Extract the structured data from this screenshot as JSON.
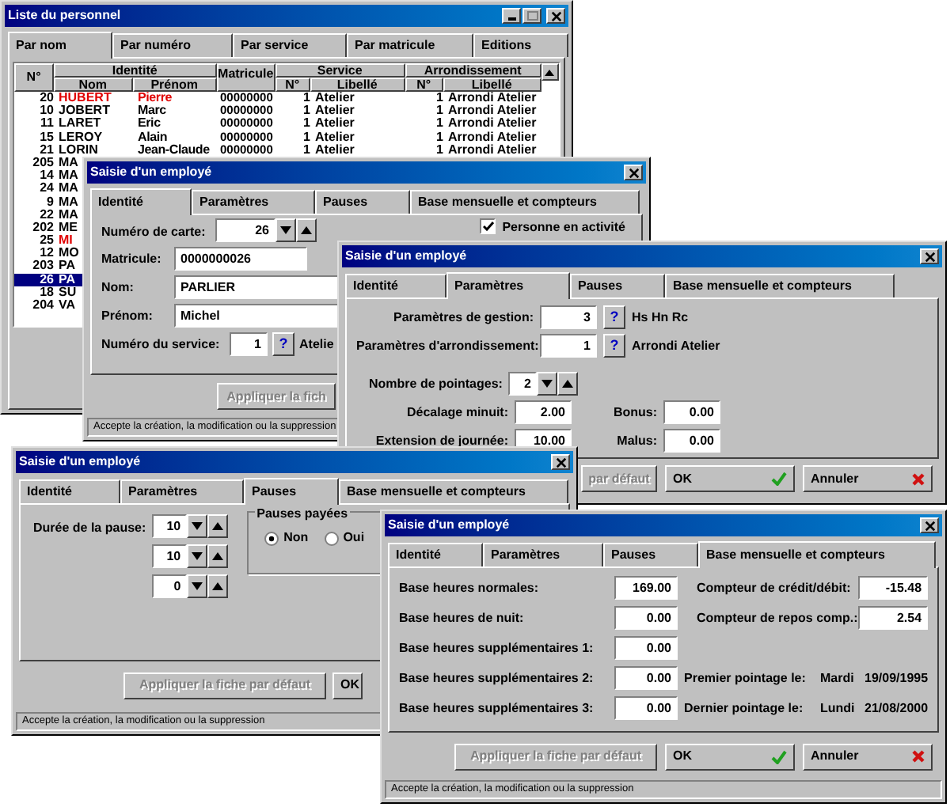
{
  "list_window": {
    "title": "Liste du personnel",
    "tabs": [
      {
        "label": "Par nom",
        "selected": true
      },
      {
        "label": "Par numéro",
        "selected": false
      },
      {
        "label": "Par service",
        "selected": false
      },
      {
        "label": "Par matricule",
        "selected": false
      },
      {
        "label": "Editions",
        "selected": false
      }
    ],
    "header_top": [
      "N°",
      "Identité",
      "Matricule",
      "Service",
      "Arrondissement"
    ],
    "header_bottom": [
      "Nom",
      "Prénom",
      "N°",
      "Libellé",
      "N°",
      "Libellé"
    ],
    "rows": [
      {
        "number": "20",
        "name": "HUBERT",
        "first_name": "Pierre",
        "matricule": "00000000",
        "service_no": "1",
        "service": "Atelier",
        "arrondi_no": "1",
        "arrondi": "Arrondi Atelier",
        "color": "#e00000",
        "selected": false
      },
      {
        "number": "10",
        "name": "JOBERT",
        "first_name": "Marc",
        "matricule": "00000000",
        "service_no": "1",
        "service": "Atelier",
        "arrondi_no": "1",
        "arrondi": "Arrondi Atelier",
        "color": "#000000",
        "selected": false
      },
      {
        "number": "11",
        "name": "LARET",
        "first_name": "Eric",
        "matricule": "00000000",
        "service_no": "1",
        "service": "Atelier",
        "arrondi_no": "1",
        "arrondi": "Arrondi Atelier",
        "color": "#000000",
        "selected": false
      },
      {
        "number": "15",
        "name": "LEROY",
        "first_name": "Alain",
        "matricule": "00000000",
        "service_no": "1",
        "service": "Atelier",
        "arrondi_no": "1",
        "arrondi": "Arrondi Atelier",
        "color": "#000000",
        "selected": false
      },
      {
        "number": "21",
        "name": "LORIN",
        "first_name": "Jean-Claude",
        "matricule": "00000000",
        "service_no": "1",
        "service": "Atelier",
        "arrondi_no": "1",
        "arrondi": "Arrondi Atelier",
        "color": "#000000",
        "selected": false
      },
      {
        "number": "205",
        "name": "MA",
        "color": "#000000",
        "selected": false
      },
      {
        "number": "14",
        "name": "MA",
        "color": "#000000",
        "selected": false
      },
      {
        "number": "24",
        "name": "MA",
        "color": "#000000",
        "selected": false
      },
      {
        "number": "9",
        "name": "MA",
        "color": "#000000",
        "selected": false
      },
      {
        "number": "22",
        "name": "MA",
        "color": "#000000",
        "selected": false
      },
      {
        "number": "202",
        "name": "ME",
        "color": "#000000",
        "selected": false
      },
      {
        "number": "25",
        "name": "MI",
        "color": "#e00000",
        "selected": false
      },
      {
        "number": "12",
        "name": "MO",
        "color": "#000000",
        "selected": false
      },
      {
        "number": "203",
        "name": "PA",
        "color": "#000000",
        "selected": false
      },
      {
        "number": "26",
        "name": "PA",
        "selected": true
      },
      {
        "number": "18",
        "name": "SU",
        "color": "#000000",
        "selected": false
      },
      {
        "number": "204",
        "name": "VA",
        "color": "#000000",
        "selected": false
      }
    ]
  },
  "identity_window": {
    "title": "Saisie d'un employé",
    "tabs": [
      {
        "label": "Identité",
        "selected": true
      },
      {
        "label": "Paramètres",
        "selected": false
      },
      {
        "label": "Pauses",
        "selected": false
      },
      {
        "label": "Base mensuelle et compteurs",
        "selected": false
      }
    ],
    "card_number": {
      "label": "Numéro de carte:",
      "value": "26"
    },
    "active": {
      "label": "Personne en activité",
      "checked": true
    },
    "matricule": {
      "label": "Matricule:",
      "value": "0000000026"
    },
    "last_name": {
      "label": "Nom:",
      "value": "PARLIER"
    },
    "first_name": {
      "label": "Prénom:",
      "value": "Michel"
    },
    "service_number": {
      "label": "Numéro du service:",
      "value": "1",
      "help": "?",
      "service": "Atelie"
    },
    "apply_button": {
      "label": "Appliquer la fich",
      "disabled": true
    },
    "status_bar": "Accepte la création, la modification ou la suppression"
  },
  "parameters_window": {
    "title": "Saisie d'un employé",
    "tabs": [
      {
        "label": "Identité",
        "selected": false
      },
      {
        "label": "Paramètres",
        "selected": true
      },
      {
        "label": "Pauses",
        "selected": false
      },
      {
        "label": "Base mensuelle et compteurs",
        "selected": false
      }
    ],
    "lookups": [
      {
        "label": "Paramètres de gestion:",
        "value": "3",
        "help": "?",
        "description": "Hs Hn Rc"
      },
      {
        "label": "Paramètres d'arrondissement:",
        "value": "1",
        "help": "?",
        "description": "Arrondi Atelier"
      }
    ],
    "punch_count": {
      "label": "Nombre de pointages:",
      "value": "2"
    },
    "values": [
      {
        "label": "Décalage minuit:",
        "value": "2.00"
      },
      {
        "label": "Bonus:",
        "value": "0.00"
      },
      {
        "label": "Extension de journée:",
        "value": "10.00"
      },
      {
        "label": "Malus:",
        "value": "0.00"
      }
    ],
    "buttons": [
      {
        "kind": "apply",
        "label": "par défaut",
        "disabled": true
      },
      {
        "kind": "ok",
        "label": "OK",
        "disabled": false
      },
      {
        "kind": "cancel",
        "label": "Annuler",
        "disabled": false
      }
    ]
  },
  "pauses_window": {
    "title": "Saisie d'un employé",
    "tabs": [
      {
        "label": "Identité",
        "selected": false
      },
      {
        "label": "Paramètres",
        "selected": false
      },
      {
        "label": "Pauses",
        "selected": true
      },
      {
        "label": "Base mensuelle et compteurs",
        "selected": false
      }
    ],
    "pause_duration": {
      "label": "Durée de la pause:",
      "values": [
        "10",
        "10",
        "0"
      ]
    },
    "paid_pauses": {
      "label": "Pauses payées",
      "options": [
        {
          "label": "Non",
          "selected": true
        },
        {
          "label": "Oui",
          "selected": false
        }
      ]
    },
    "buttons": [
      {
        "kind": "apply",
        "label": "Appliquer la fiche par défaut",
        "disabled": true
      },
      {
        "kind": "ok_partial",
        "label": "OK",
        "disabled": false
      }
    ],
    "status_bar": "Accepte la création, la modification ou la suppression"
  },
  "counters_window": {
    "title": "Saisie d'un employé",
    "tabs": [
      {
        "label": "Identité",
        "selected": false
      },
      {
        "label": "Paramètres",
        "selected": false
      },
      {
        "label": "Pauses",
        "selected": false
      },
      {
        "label": "Base mensuelle et compteurs",
        "selected": true
      }
    ],
    "bases": [
      {
        "label": "Base heures normales:",
        "value": "169.00"
      },
      {
        "label": "Base heures de nuit:",
        "value": "0.00"
      },
      {
        "label": "Base heures supplémentaires 1:",
        "value": "0.00"
      },
      {
        "label": "Base heures supplémentaires 2:",
        "value": "0.00"
      },
      {
        "label": "Base heures supplémentaires 3:",
        "value": "0.00"
      }
    ],
    "counters": [
      {
        "label": "Compteur de crédit/débit:",
        "value": "-15.48"
      },
      {
        "label": "Compteur de repos comp.:",
        "value": "2.54"
      }
    ],
    "dates": [
      {
        "label": "Premier pointage le:",
        "day": "Mardi",
        "date": "19/09/1995"
      },
      {
        "label": "Dernier pointage le:",
        "day": "Lundi",
        "date": "21/08/2000"
      }
    ],
    "buttons": [
      {
        "kind": "apply",
        "label": "Appliquer la fiche par défaut",
        "disabled": true
      },
      {
        "kind": "ok",
        "label": "OK",
        "disabled": false
      },
      {
        "kind": "cancel",
        "label": "Annuler",
        "disabled": false
      }
    ],
    "status_bar": "Accepte la création, la modification ou la suppression"
  }
}
